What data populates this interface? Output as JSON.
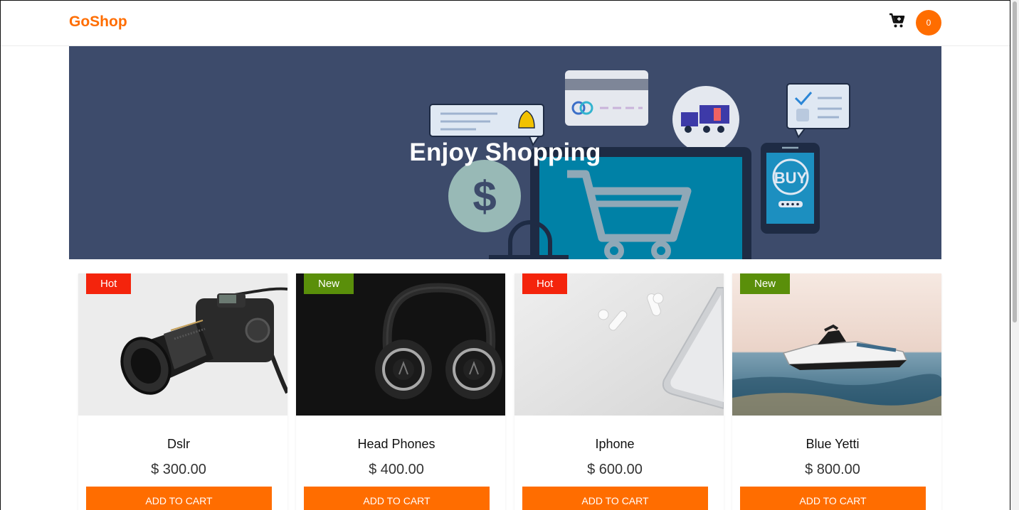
{
  "navbar": {
    "brand": "GoShop",
    "cart_count": "0",
    "cart_icon": "cart-plus-icon",
    "brand_color": "#ff6d00"
  },
  "hero": {
    "title": "Enjoy Shopping",
    "illustration_text": {
      "buy_label": "BUY",
      "currency_symbol": "$"
    },
    "background_color": "#3d4b6b"
  },
  "products": [
    {
      "badge": "Hot",
      "badge_type": "hot",
      "name": "Dslr",
      "price": "$ 300.00",
      "button": "ADD TO CART",
      "image": "dslr-camera-image"
    },
    {
      "badge": "New",
      "badge_type": "new",
      "name": "Head Phones",
      "price": "$ 400.00",
      "button": "ADD TO CART",
      "image": "headphones-image"
    },
    {
      "badge": "Hot",
      "badge_type": "hot",
      "name": "Iphone",
      "price": "$ 600.00",
      "button": "ADD TO CART",
      "image": "iphone-airpods-image"
    },
    {
      "badge": "New",
      "badge_type": "new",
      "name": "Blue Yetti",
      "price": "$ 800.00",
      "button": "ADD TO CART",
      "image": "jet-ski-image"
    }
  ],
  "colors": {
    "accent": "#ff6d00",
    "hot_badge": "#f4240c",
    "new_badge": "#5a8f0a"
  }
}
